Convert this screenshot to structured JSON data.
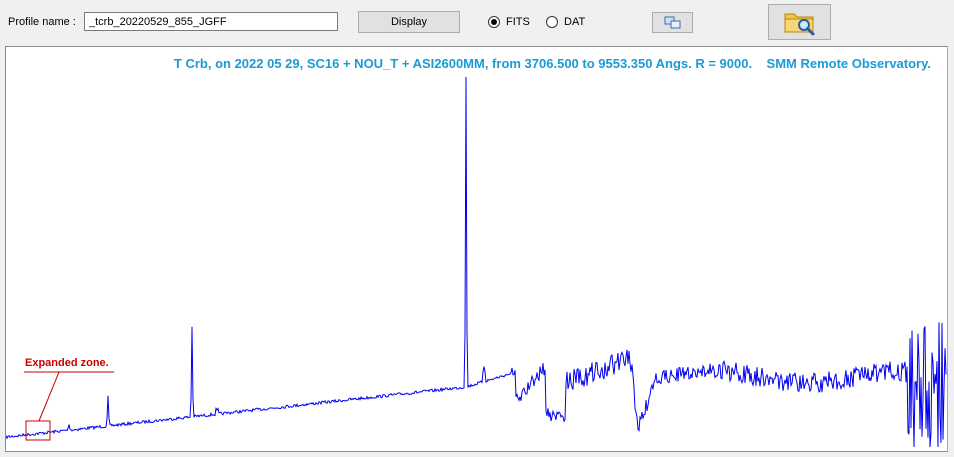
{
  "toolbar": {
    "profile_label": "Profile name :",
    "profile_value": "_tcrb_20220529_855_JGFF",
    "display_label": "Display",
    "format_options": [
      {
        "label": "FITS",
        "selected": true
      },
      {
        "label": "DAT",
        "selected": false
      }
    ],
    "copy_icon": "copy-windows-icon",
    "folder_icon": "folder-search-icon"
  },
  "plot": {
    "title": "T Crb, on 2022 05 29, SC16 + NOU_T + ASI2600MM, from 3706.500 to 9553.350 Angs. R = 9000.    SMM Remote Observatory.",
    "annotation": "Expanded zone.",
    "title_color": "#1a9bd6",
    "line_color": "#0000ee",
    "annotation_color": "#cc0000"
  },
  "chart_data": {
    "type": "line",
    "x_range": [
      3706.5,
      9553.35
    ],
    "grid": false,
    "features": [
      {
        "x": 4861,
        "peak": 0.31
      },
      {
        "x": 5015,
        "peak": 0.08
      },
      {
        "x": 6563,
        "peak": 1.0
      },
      {
        "x": 6678,
        "peak": 0.2
      },
      {
        "x": 4340,
        "peak": 0.12
      },
      {
        "x": 4101,
        "peak": 0.04
      }
    ]
  }
}
